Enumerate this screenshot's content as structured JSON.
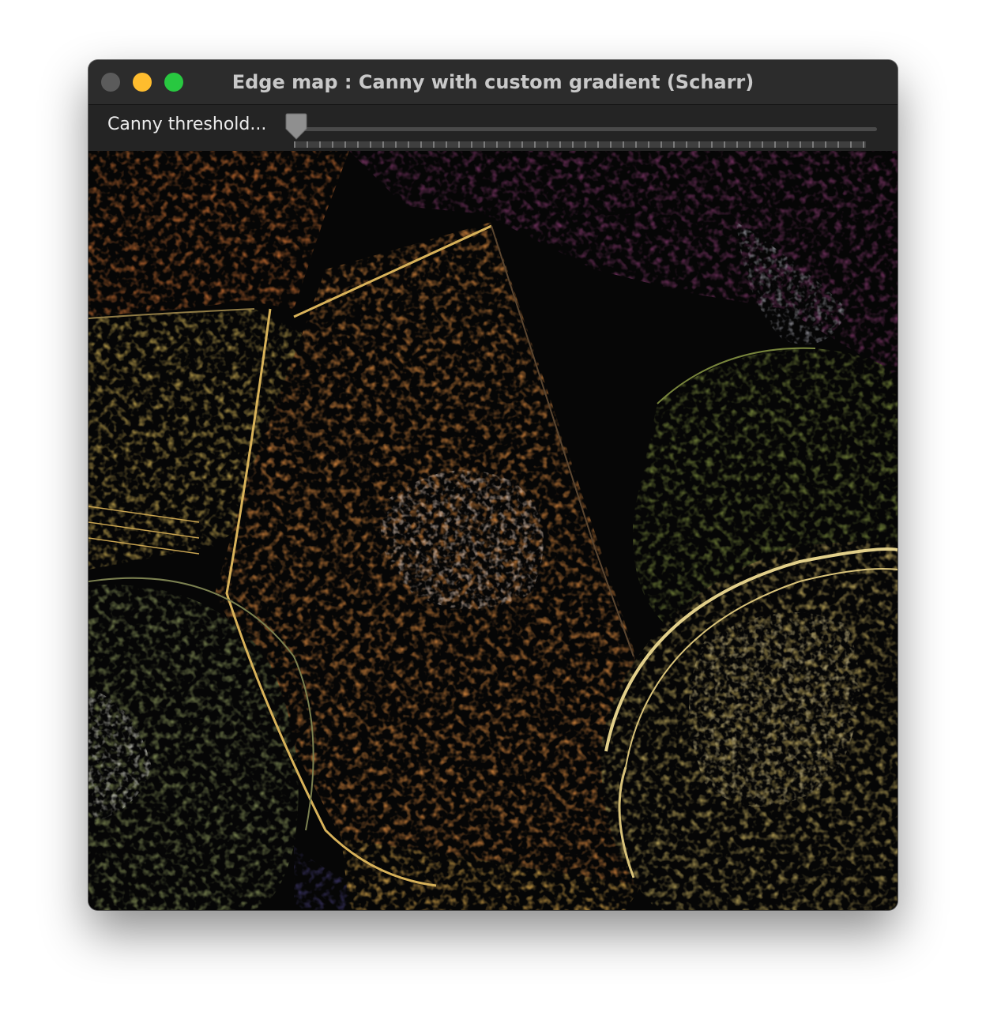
{
  "window": {
    "title": "Edge map : Canny with custom gradient (Scharr)",
    "traffic_lights": {
      "close": {
        "color": "#5b5b5b",
        "icon": "close-icon"
      },
      "minimize": {
        "color": "#febc2e",
        "icon": "minimize-icon"
      },
      "zoom": {
        "color": "#28c840",
        "icon": "zoom-icon"
      }
    }
  },
  "toolbar": {
    "slider_label": "Canny threshold...",
    "slider_value_fraction": 0.0,
    "thumb_color": "#8f8f8f"
  },
  "image": {
    "subject": "edge-detected fruit photo",
    "palette": {
      "orange": "#d08a3c",
      "gold": "#cfae55",
      "green": "#7d8a45",
      "purple": "#7a3a66",
      "gray": "#9b9b8f"
    }
  }
}
